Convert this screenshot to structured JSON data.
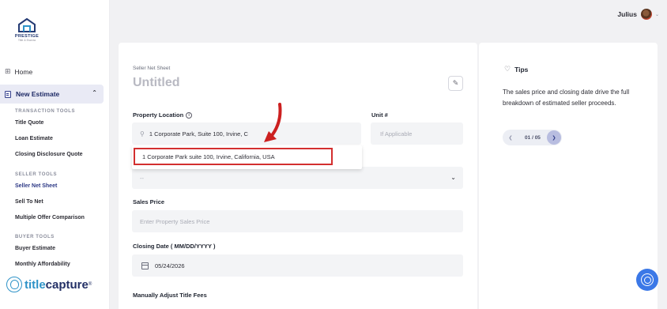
{
  "brand": {
    "name": "PRESTIGE",
    "sub": "Title & Escrow"
  },
  "nav": {
    "home": "Home",
    "new_estimate": "New Estimate",
    "sections": [
      {
        "header": "TRANSACTION TOOLS",
        "items": [
          "Title Quote",
          "Loan Estimate",
          "Closing Disclosure Quote"
        ]
      },
      {
        "header": "SELLER TOOLS",
        "items": [
          "Seller Net Sheet",
          "Sell To Net",
          "Multiple Offer Comparison"
        ]
      },
      {
        "header": "BUYER TOOLS",
        "items": [
          "Buyer Estimate",
          "Monthly Affordability"
        ]
      }
    ],
    "active_item": "Seller Net Sheet"
  },
  "footer_logo": {
    "title": "title",
    "capture": "capture",
    "reg": "®"
  },
  "user": {
    "name": "Julius"
  },
  "form": {
    "breadcrumb": "Seller Net Sheet",
    "title": "Untitled",
    "property_location_label": "Property Location",
    "property_location_value": "1 Corporate Park, Suite 100, Irvine, C",
    "unit_label": "Unit #",
    "unit_placeholder": "If Applicable",
    "suggestion": "1 Corporate Park suite 100, Irvine, California, USA",
    "dropdown_value": "--",
    "sales_price_label": "Sales Price",
    "sales_price_placeholder": "Enter Property Sales Price",
    "closing_date_label": "Closing Date ( MM/DD/YYYY )",
    "closing_date_value": "05/24/2026",
    "manually_adjust_label": "Manually Adjust Title Fees"
  },
  "tips": {
    "header": "Tips",
    "text": "The sales price and closing date drive the full breakdown of estimated seller proceeds.",
    "pager": "01 / 05"
  },
  "colors": {
    "accent": "#2c3885",
    "highlight": "#d32f2f",
    "fab": "#3b78e7"
  }
}
